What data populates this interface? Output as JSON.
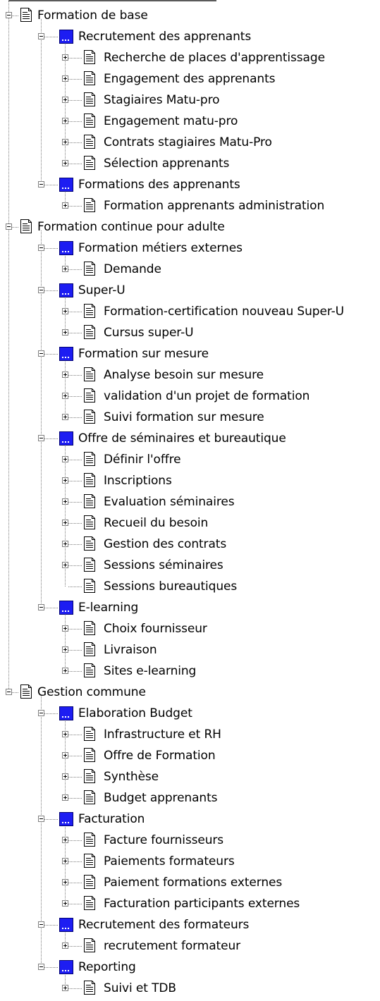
{
  "tree": [
    {
      "label": "Formation de base",
      "icon": "document-icon",
      "children": [
        {
          "label": "Recrutement des apprenants",
          "icon": "folder-icon",
          "children": [
            {
              "label": "Recherche de places d'apprentissage",
              "icon": "document-icon",
              "toggle": "plus"
            },
            {
              "label": "Engagement des apprenants",
              "icon": "document-icon",
              "toggle": "plus"
            },
            {
              "label": "Stagiaires Matu-pro",
              "icon": "document-icon",
              "toggle": "plus"
            },
            {
              "label": "Engagement matu-pro",
              "icon": "document-icon",
              "toggle": "plus"
            },
            {
              "label": "Contrats stagiaires Matu-Pro",
              "icon": "document-icon",
              "toggle": "plus"
            },
            {
              "label": "Sélection apprenants",
              "icon": "document-icon",
              "toggle": "plus"
            }
          ]
        },
        {
          "label": "Formations des apprenants",
          "icon": "folder-icon",
          "children": [
            {
              "label": "Formation apprenants administration",
              "icon": "document-icon",
              "toggle": "plus"
            }
          ]
        }
      ]
    },
    {
      "label": "Formation continue pour adulte",
      "icon": "document-icon",
      "children": [
        {
          "label": "Formation métiers externes",
          "icon": "folder-icon",
          "children": [
            {
              "label": "Demande",
              "icon": "document-icon",
              "toggle": "plus"
            }
          ]
        },
        {
          "label": "Super-U",
          "icon": "folder-icon",
          "children": [
            {
              "label": "Formation-certification nouveau Super-U",
              "icon": "document-icon",
              "toggle": "plus"
            },
            {
              "label": "Cursus super-U",
              "icon": "document-icon",
              "toggle": "plus"
            }
          ]
        },
        {
          "label": "Formation sur mesure",
          "icon": "folder-icon",
          "children": [
            {
              "label": "Analyse besoin sur mesure",
              "icon": "document-icon",
              "toggle": "plus"
            },
            {
              "label": "validation d'un projet de formation",
              "icon": "document-icon",
              "toggle": "plus"
            },
            {
              "label": "Suivi formation sur mesure",
              "icon": "document-icon",
              "toggle": "plus"
            }
          ]
        },
        {
          "label": "Offre de séminaires et bureautique",
          "icon": "folder-icon",
          "children": [
            {
              "label": "Définir l'offre",
              "icon": "document-icon",
              "toggle": "plus"
            },
            {
              "label": "Inscriptions",
              "icon": "document-icon",
              "toggle": "plus"
            },
            {
              "label": "Evaluation séminaires",
              "icon": "document-icon",
              "toggle": "plus"
            },
            {
              "label": "Recueil du besoin",
              "icon": "document-icon",
              "toggle": "plus"
            },
            {
              "label": "Gestion des contrats",
              "icon": "document-icon",
              "toggle": "plus"
            },
            {
              "label": "Sessions séminaires",
              "icon": "document-icon",
              "toggle": "plus"
            },
            {
              "label": "Sessions bureautiques",
              "icon": "document-icon",
              "toggle": "none"
            }
          ]
        },
        {
          "label": "E-learning",
          "icon": "folder-icon",
          "children": [
            {
              "label": "Choix fournisseur",
              "icon": "document-icon",
              "toggle": "plus"
            },
            {
              "label": "Livraison",
              "icon": "document-icon",
              "toggle": "plus"
            },
            {
              "label": "Sites e-learning",
              "icon": "document-icon",
              "toggle": "plus"
            }
          ]
        }
      ]
    },
    {
      "label": "Gestion commune",
      "icon": "document-icon",
      "children": [
        {
          "label": "Elaboration Budget",
          "icon": "folder-icon",
          "children": [
            {
              "label": "Infrastructure et RH",
              "icon": "document-icon",
              "toggle": "plus"
            },
            {
              "label": "Offre de Formation",
              "icon": "document-icon",
              "toggle": "plus"
            },
            {
              "label": "Synthèse",
              "icon": "document-icon",
              "toggle": "plus"
            },
            {
              "label": "Budget apprenants",
              "icon": "document-icon",
              "toggle": "plus"
            }
          ]
        },
        {
          "label": "Facturation",
          "icon": "folder-icon",
          "children": [
            {
              "label": "Facture fournisseurs",
              "icon": "document-icon",
              "toggle": "plus"
            },
            {
              "label": "Paiements formateurs",
              "icon": "document-icon",
              "toggle": "plus"
            },
            {
              "label": "Paiement formations externes",
              "icon": "document-icon",
              "toggle": "plus"
            },
            {
              "label": "Facturation participants externes",
              "icon": "document-icon",
              "toggle": "plus"
            }
          ]
        },
        {
          "label": "Recrutement des formateurs",
          "icon": "folder-icon",
          "children": [
            {
              "label": "recrutement formateur",
              "icon": "document-icon",
              "toggle": "plus"
            }
          ]
        },
        {
          "label": "Reporting",
          "icon": "folder-icon",
          "children": [
            {
              "label": "Suivi et TDB",
              "icon": "document-icon",
              "toggle": "plus"
            }
          ]
        }
      ]
    }
  ],
  "colors": {
    "folder": "#1d1df2",
    "line": "#7f7f7f",
    "text": "#000000",
    "background": "#ffffff"
  }
}
